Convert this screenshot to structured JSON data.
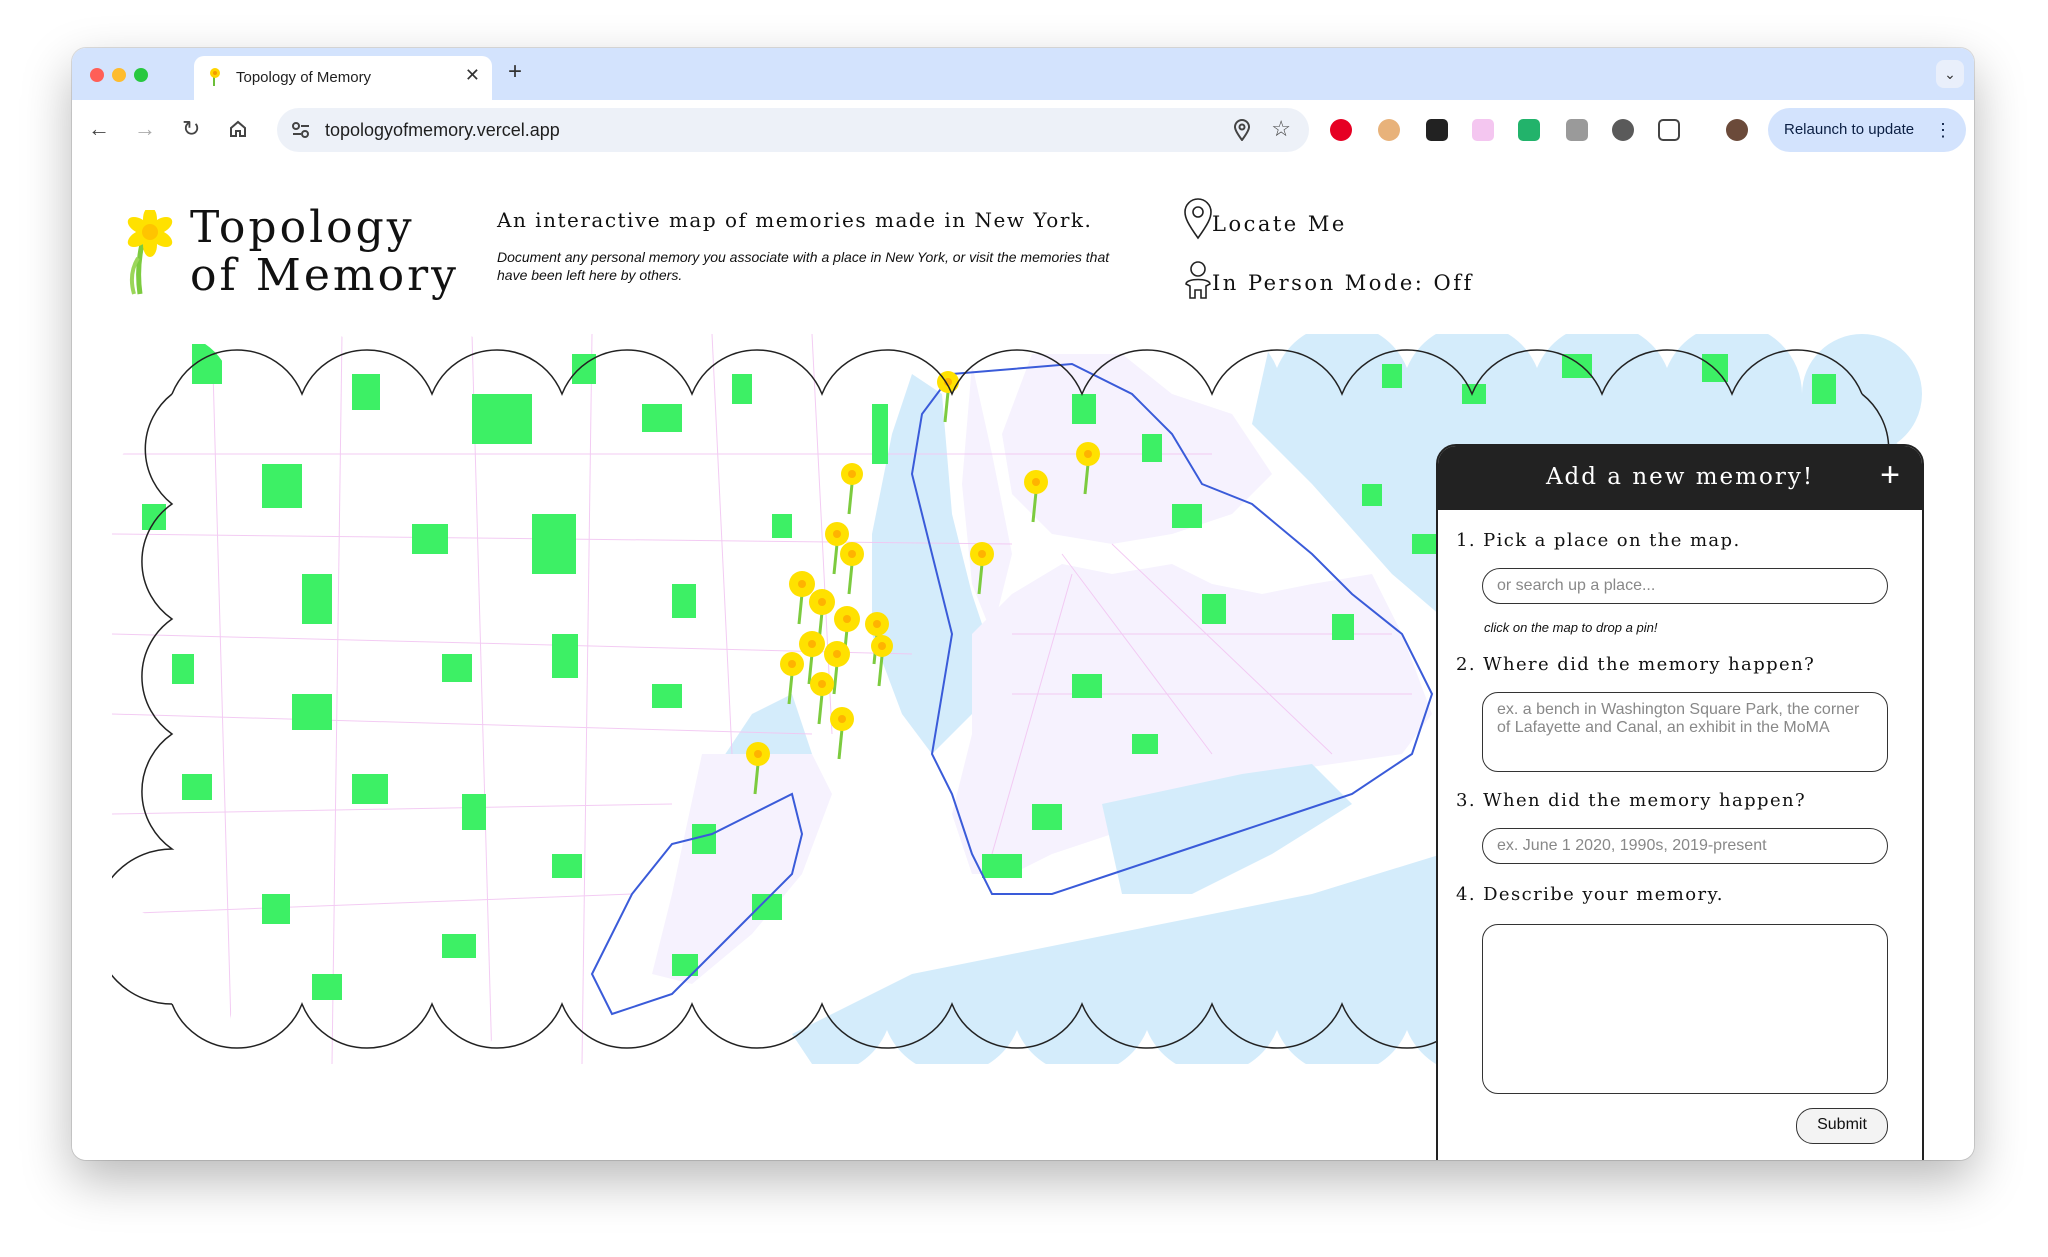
{
  "browser": {
    "tab_title": "Topology of Memory",
    "url": "topologyofmemory.vercel.app",
    "relaunch_label": "Relaunch to update"
  },
  "header": {
    "title_line1": "Topology",
    "title_line2": "of Memory",
    "tagline": "An interactive map of memories made in New York.",
    "description": "Document any personal memory you associate with a place in New York, or visit the memories that have been left here by others.",
    "locate_label": "Locate Me",
    "in_person_label": "In Person Mode: Off"
  },
  "panel": {
    "title": "Add a new memory!",
    "step1": "1. Pick a place on the map.",
    "search_placeholder": "or search up a place...",
    "hint": "click on the map to drop a pin!",
    "step2": "2. Where did the memory happen?",
    "where_placeholder": "ex. a bench in Washington Square Park, the corner of Lafayette and Canal, an exhibit in the MoMA",
    "step3": "3. When did the memory happen?",
    "when_placeholder": "ex. June 1 2020, 1990s, 2019-present",
    "step4": "4. Describe your memory.",
    "submit_label": "Submit"
  },
  "colors": {
    "park": "#3df065",
    "water": "#d4ecfb",
    "street": "#f2c6f2",
    "border": "#3a5bd9",
    "daffodil": "#ffe100"
  }
}
